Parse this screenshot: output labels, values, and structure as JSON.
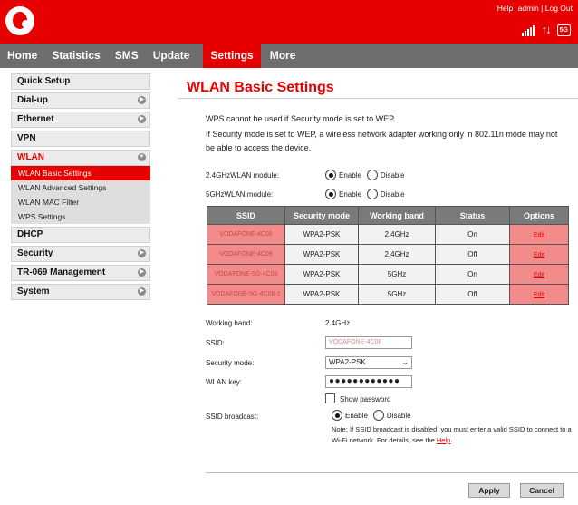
{
  "header": {
    "links": {
      "help": "Help",
      "admin": "admin",
      "separator": "|",
      "logout": "Log Out"
    },
    "network_badge": "5G"
  },
  "nav": {
    "items": [
      {
        "label": "Home"
      },
      {
        "label": "Statistics"
      },
      {
        "label": "SMS"
      },
      {
        "label": "Update"
      },
      {
        "label": "Settings",
        "active": true
      },
      {
        "label": "More"
      }
    ]
  },
  "sidebar": {
    "items": [
      {
        "label": "Quick Setup"
      },
      {
        "label": "Dial-up"
      },
      {
        "label": "Ethernet"
      },
      {
        "label": "VPN"
      },
      {
        "label": "WLAN",
        "active": true
      },
      {
        "label": "DHCP"
      },
      {
        "label": "Security"
      },
      {
        "label": "TR-069 Management"
      },
      {
        "label": "System"
      }
    ],
    "wlan_sub": [
      {
        "label": "WLAN Basic Settings",
        "active": true
      },
      {
        "label": "WLAN Advanced Settings"
      },
      {
        "label": "WLAN MAC Filter"
      },
      {
        "label": "WPS Settings"
      }
    ]
  },
  "main": {
    "title": "WLAN Basic Settings",
    "note_line1": "WPS cannot be used if Security mode is set to WEP.",
    "note_line2": "If Security mode is set to WEP, a wireless network adapter working only in 802.11n mode may not be able to access the device.",
    "module_24_label": "2.4GHzWLAN module:",
    "module_5_label": "5GHzWLAN module:",
    "enable_label": "Enable",
    "disable_label": "Disable",
    "table": {
      "headers": [
        "SSID",
        "Security mode",
        "Working band",
        "Status",
        "Options"
      ],
      "rows": [
        {
          "ssid": "VODAFONE-4C08",
          "security": "WPA2-PSK",
          "band": "2.4GHz",
          "status": "On",
          "option": "Edit"
        },
        {
          "ssid": "VODAFONE-4C09",
          "security": "WPA2-PSK",
          "band": "2.4GHz",
          "status": "Off",
          "option": "Edit"
        },
        {
          "ssid": "VODAFONE-5G-4C08",
          "security": "WPA2-PSK",
          "band": "5GHz",
          "status": "On",
          "option": "Edit"
        },
        {
          "ssid": "VODAFONE-5G-4C08-1",
          "security": "WPA2-PSK",
          "band": "5GHz",
          "status": "Off",
          "option": "Edit"
        }
      ]
    },
    "form": {
      "working_band_label": "Working band:",
      "working_band_value": "2.4GHz",
      "ssid_label": "SSID:",
      "ssid_value": "VODAFONE-4C08",
      "security_label": "Security mode:",
      "security_value": "WPA2-PSK",
      "key_label": "WLAN key:",
      "key_value": "●●●●●●●●●●●●",
      "show_password": "Show password",
      "broadcast_label": "SSID broadcast:",
      "broadcast_note_prefix": "Note: If SSID broadcast is disabled, you must enter a valid SSID to connect to a Wi-Fi network. For details, see the ",
      "broadcast_note_link": "Help",
      "broadcast_note_suffix": "."
    },
    "buttons": {
      "apply": "Apply",
      "cancel": "Cancel"
    }
  },
  "colors": {
    "brand_red": "#e60000",
    "nav_grey": "#6e6e6e",
    "table_header": "#7a7a7a",
    "highlight_pink": "#f48b8b"
  }
}
